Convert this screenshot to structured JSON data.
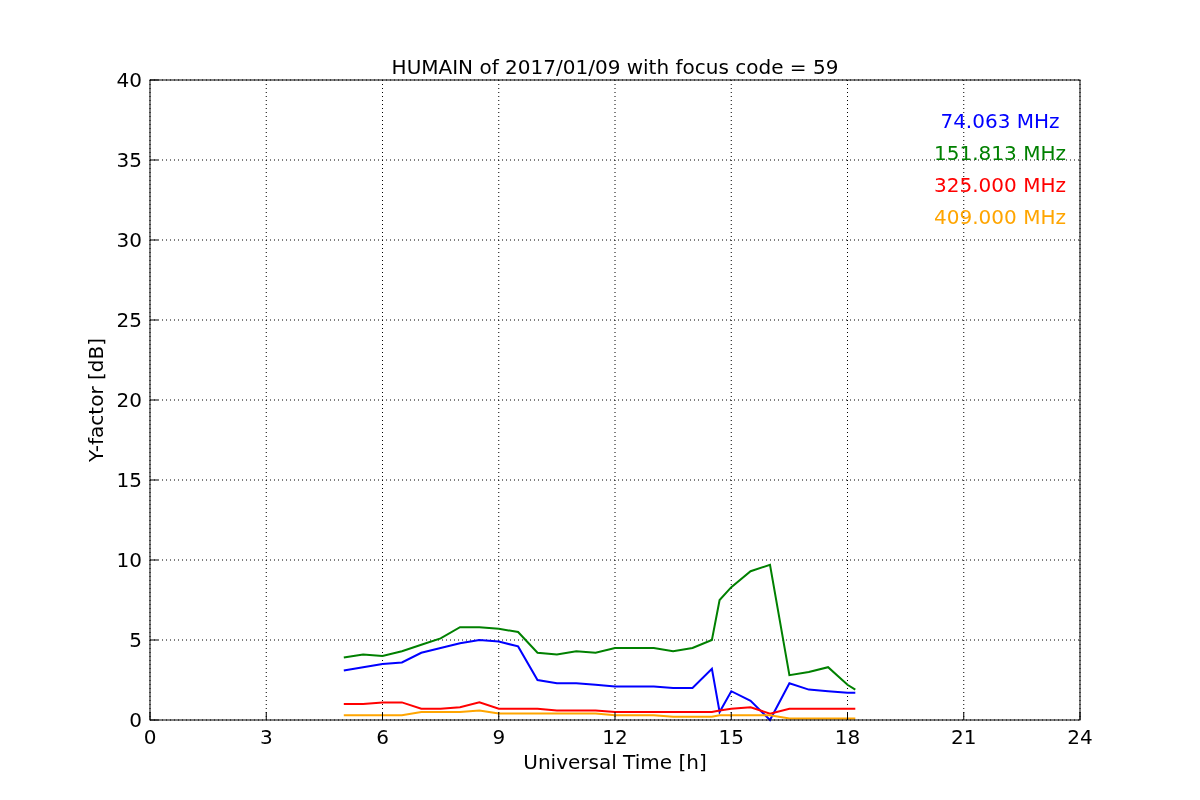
{
  "figure": {
    "chart_data": {
      "type": "line",
      "title": "HUMAIN of 2017/01/09 with focus code = 59",
      "xlabel": "Universal Time [h]",
      "ylabel": "Y-factor [dB]",
      "x": [
        5,
        5.5,
        6,
        6.5,
        7,
        7.5,
        8,
        8.5,
        9,
        9.5,
        10,
        10.5,
        11,
        11.5,
        12,
        12.5,
        13,
        13.5,
        14,
        14.5,
        14.7,
        15,
        15.5,
        16,
        16.5,
        17,
        17.5,
        18,
        18.2
      ],
      "series": [
        {
          "name": "74.063 MHz",
          "color": "#0000ff",
          "values": [
            3.1,
            3.3,
            3.5,
            3.6,
            4.2,
            4.5,
            4.8,
            5.0,
            4.9,
            4.6,
            2.5,
            2.3,
            2.3,
            2.2,
            2.1,
            2.1,
            2.1,
            2.0,
            2.0,
            3.2,
            0.5,
            1.8,
            1.2,
            0.0,
            2.3,
            1.9,
            1.8,
            1.7,
            1.7
          ]
        },
        {
          "name": "151.813 MHz",
          "color": "#008000",
          "values": [
            3.9,
            4.1,
            4.0,
            4.3,
            4.7,
            5.1,
            5.8,
            5.8,
            5.7,
            5.5,
            4.2,
            4.1,
            4.3,
            4.2,
            4.5,
            4.5,
            4.5,
            4.3,
            4.5,
            5.0,
            7.5,
            8.3,
            9.3,
            9.7,
            2.8,
            3.0,
            3.3,
            2.2,
            1.9
          ]
        },
        {
          "name": "325.000 MHz",
          "color": "#ff0000",
          "values": [
            1.0,
            1.0,
            1.1,
            1.1,
            0.7,
            0.7,
            0.8,
            1.1,
            0.7,
            0.7,
            0.7,
            0.6,
            0.6,
            0.6,
            0.5,
            0.5,
            0.5,
            0.5,
            0.5,
            0.5,
            0.6,
            0.7,
            0.8,
            0.4,
            0.7,
            0.7,
            0.7,
            0.7,
            0.7
          ]
        },
        {
          "name": "409.000 MHz",
          "color": "#ffa500",
          "values": [
            0.3,
            0.3,
            0.3,
            0.3,
            0.5,
            0.5,
            0.5,
            0.6,
            0.4,
            0.4,
            0.4,
            0.4,
            0.4,
            0.4,
            0.3,
            0.3,
            0.3,
            0.2,
            0.2,
            0.2,
            0.3,
            0.3,
            0.3,
            0.3,
            0.1,
            0.1,
            0.1,
            0.1,
            0.1
          ]
        }
      ],
      "grid": true,
      "xlim": [
        0,
        24
      ],
      "ylim": [
        0,
        40
      ],
      "xticks": [
        0,
        3,
        6,
        9,
        12,
        15,
        18,
        21,
        24
      ],
      "yticks": [
        0,
        5,
        10,
        15,
        20,
        25,
        30,
        35,
        40
      ]
    }
  }
}
